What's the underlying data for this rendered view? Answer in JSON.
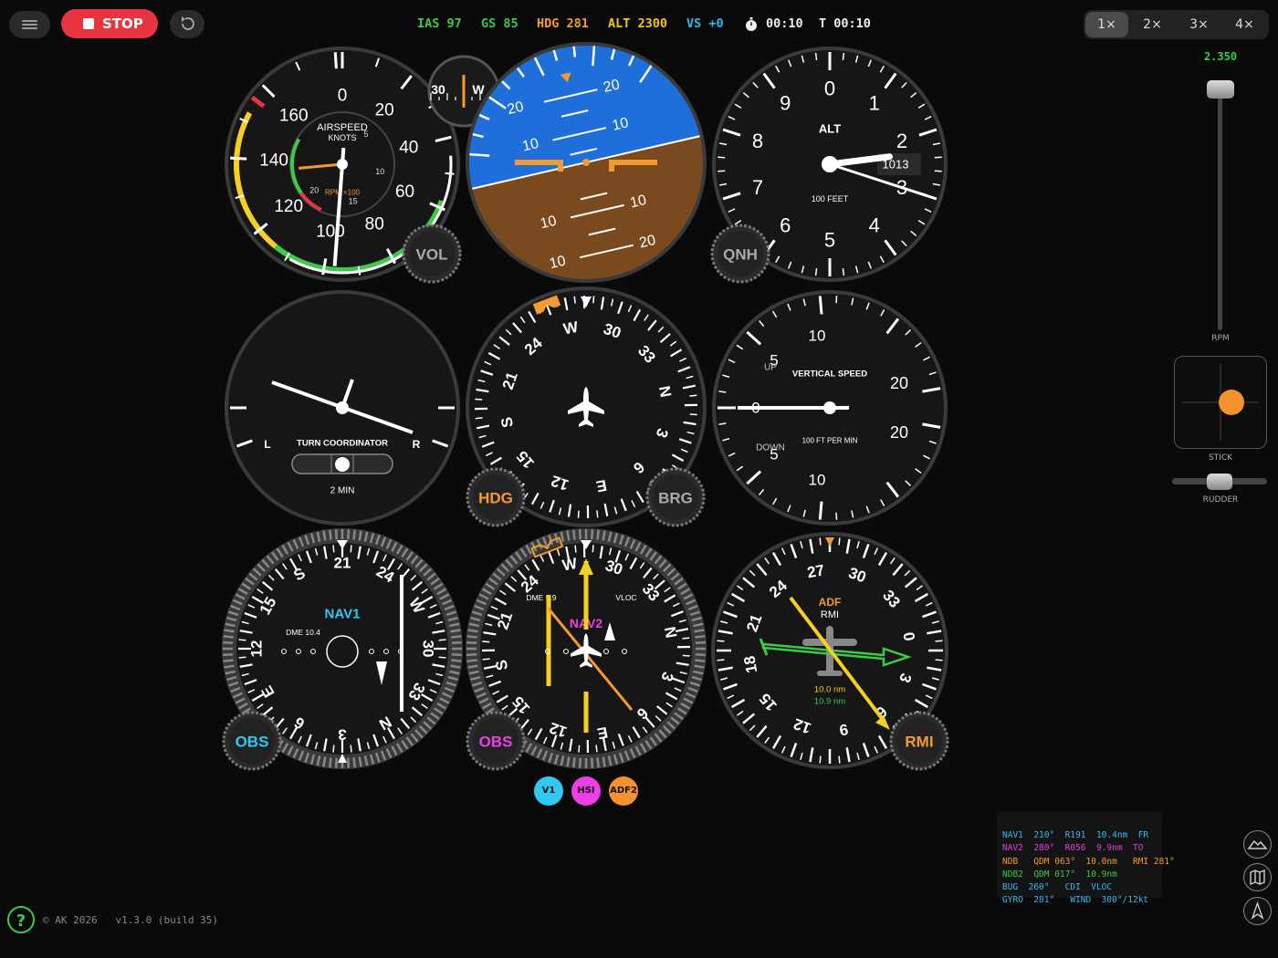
{
  "topbar": {
    "stop_label": "STOP",
    "status": [
      {
        "label": "IAS",
        "value": "97",
        "color": "#3ec94a"
      },
      {
        "label": "GS",
        "value": "85",
        "color": "#3ec94a"
      },
      {
        "label": "HDG",
        "value": "281",
        "color": "#f59a2e"
      },
      {
        "label": "ALT",
        "value": "2300",
        "color": "#f5c518"
      },
      {
        "label": "VS",
        "value": "+0",
        "color": "#2fb8f0"
      }
    ],
    "timer": "00:10",
    "total_time": "T 00:10",
    "sim_speeds": [
      "1×",
      "2×",
      "3×",
      "4×"
    ],
    "sim_speed_active": 0
  },
  "airspeed": {
    "label1": "AIRSPEED",
    "label2": "KNOTS",
    "ticks": [
      "0",
      "20",
      "40",
      "60",
      "80",
      "100",
      "120",
      "140",
      "160"
    ],
    "needle_kt": 97,
    "rpm_label": "RPM ×100",
    "rpm_ticks": [
      "5",
      "10",
      "15",
      "20"
    ],
    "rpm_value": 23.5,
    "knob": "VOL"
  },
  "mini_compass": {
    "labels": [
      "30",
      "W"
    ]
  },
  "attitude": {
    "pitch_labels": [
      "20",
      "10",
      "10",
      "10",
      "20",
      "10",
      "10",
      "20"
    ]
  },
  "altimeter": {
    "label": "ALT",
    "sublabel": "100 FEET",
    "digits": [
      "0",
      "1",
      "2",
      "3",
      "4",
      "5",
      "6",
      "7",
      "8",
      "9"
    ],
    "kollsman": "1013",
    "knob": "QNH",
    "altitude_ft": 2300
  },
  "turn_coordinator": {
    "label": "TURN COORDINATOR",
    "left": "L",
    "right": "R",
    "sub": "2 MIN"
  },
  "heading_indicator": {
    "labels": [
      "N",
      "3",
      "6",
      "E",
      "12",
      "15",
      "S",
      "21",
      "24",
      "W",
      "30",
      "33"
    ],
    "heading": 281,
    "knob_left": "HDG",
    "knob_right": "BRG"
  },
  "vsi": {
    "label": "VERTICAL SPEED",
    "sub": "100 FT PER MIN",
    "up": "UP",
    "down": "DOWN",
    "numbers_up": [
      "5",
      "10",
      "20"
    ],
    "numbers_down": [
      "5",
      "10",
      "20"
    ],
    "zero": "0",
    "value_fpm": 0
  },
  "nav1": {
    "label": "NAV1",
    "dme": "DME 10.4",
    "labels": [
      "N",
      "3",
      "6",
      "E",
      "12",
      "15",
      "S",
      "21",
      "24",
      "W",
      "30",
      "33"
    ],
    "obs": 210,
    "knob": "OBS"
  },
  "hsi": {
    "label": "NAV2",
    "dme": "DME 9.9",
    "source": "VLOC",
    "labels": [
      "N",
      "3",
      "6",
      "E",
      "12",
      "15",
      "S",
      "21",
      "24",
      "W",
      "30",
      "33"
    ],
    "heading": 281,
    "course": 280,
    "knob": "OBS"
  },
  "rmi": {
    "label": "ADF",
    "sublabel": "RMI",
    "dist1": "10.0 nm",
    "dist2": "10.9 nm",
    "labels": [
      "0",
      "3",
      "6",
      "9",
      "12",
      "15",
      "18",
      "21",
      "24",
      "27",
      "30",
      "33"
    ],
    "heading": 281,
    "knob": "RMI"
  },
  "modes": [
    {
      "label": "V1",
      "color": "#2fc8f0"
    },
    {
      "label": "HSI",
      "color": "#ee3ee6"
    },
    {
      "label": "ADF2",
      "color": "#f5922e"
    }
  ],
  "right_panel": {
    "rpm_value": "2.350",
    "rpm_label": "RPM",
    "stick_label": "STICK",
    "rudder_label": "RUDDER"
  },
  "readout": [
    {
      "text": "NAV1  210°  R191  10.4nm  FR",
      "color": "#3ab8f0"
    },
    {
      "text": "NAV2  280°  R056  9.9nm  TO",
      "color": "#e040e0"
    },
    {
      "text": "NDB   QDM 063°  10.0nm   RMI 281°",
      "color": "#f59a2e"
    },
    {
      "text": "NDB2  QDM 017°  10.9nm",
      "color": "#3ec94a"
    },
    {
      "text": "BUG  260°   CDI  VLOC",
      "color": "#3ab8f0"
    },
    {
      "text": "GYRO  281°   WIND  300°/12kt",
      "color": "#3ab8f0"
    }
  ],
  "footer": {
    "help": "?",
    "text": "© AK 2026   v1.3.0 (build 35)"
  },
  "colors": {
    "green": "#3ec94a",
    "yellow": "#f5d020",
    "orange": "#f59a2e",
    "red": "#e8343e",
    "sky": "#1e6fd9",
    "ground": "#7a4a1e"
  }
}
